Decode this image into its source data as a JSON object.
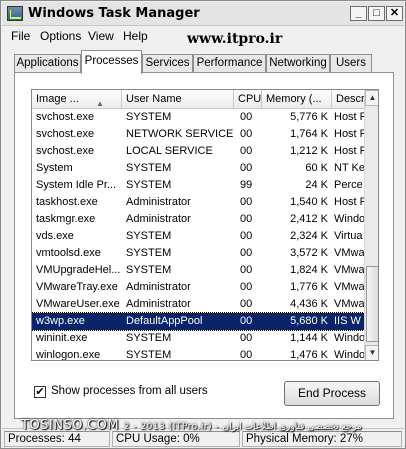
{
  "window": {
    "title": "Windows Task Manager"
  },
  "menu": [
    "File",
    "Options",
    "View",
    "Help"
  ],
  "watermark_top": "www.itpro.ir",
  "tabs": [
    "Applications",
    "Processes",
    "Services",
    "Performance",
    "Networking",
    "Users"
  ],
  "active_tab": "Processes",
  "table": {
    "columns": [
      "Image ...",
      "User Name",
      "CPU",
      "Memory (...",
      "Descr"
    ],
    "rows": [
      {
        "image": "svchost.exe",
        "user": "SYSTEM",
        "cpu": "00",
        "mem": "5,776 K",
        "desc": "Host P"
      },
      {
        "image": "svchost.exe",
        "user": "NETWORK SERVICE",
        "cpu": "00",
        "mem": "1,764 K",
        "desc": "Host P"
      },
      {
        "image": "svchost.exe",
        "user": "LOCAL SERVICE",
        "cpu": "00",
        "mem": "1,212 K",
        "desc": "Host P"
      },
      {
        "image": "System",
        "user": "SYSTEM",
        "cpu": "00",
        "mem": "60 K",
        "desc": "NT Ke"
      },
      {
        "image": "System Idle Pr...",
        "user": "SYSTEM",
        "cpu": "99",
        "mem": "24 K",
        "desc": "Perce"
      },
      {
        "image": "taskhost.exe",
        "user": "Administrator",
        "cpu": "00",
        "mem": "1,540 K",
        "desc": "Host P"
      },
      {
        "image": "taskmgr.exe",
        "user": "Administrator",
        "cpu": "00",
        "mem": "2,412 K",
        "desc": "Windo"
      },
      {
        "image": "vds.exe",
        "user": "SYSTEM",
        "cpu": "00",
        "mem": "2,324 K",
        "desc": "Virtua"
      },
      {
        "image": "vmtoolsd.exe",
        "user": "SYSTEM",
        "cpu": "00",
        "mem": "3,572 K",
        "desc": "VMwa"
      },
      {
        "image": "VMUpgradeHel...",
        "user": "SYSTEM",
        "cpu": "00",
        "mem": "1,824 K",
        "desc": "VMwa"
      },
      {
        "image": "VMwareTray.exe",
        "user": "Administrator",
        "cpu": "00",
        "mem": "1,776 K",
        "desc": "VMwa"
      },
      {
        "image": "VMwareUser.exe",
        "user": "Administrator",
        "cpu": "00",
        "mem": "4,436 K",
        "desc": "VMwa"
      },
      {
        "image": "w3wp.exe",
        "user": "DefaultAppPool",
        "cpu": "00",
        "mem": "5,680 K",
        "desc": "IIS W"
      },
      {
        "image": "wininit.exe",
        "user": "SYSTEM",
        "cpu": "00",
        "mem": "1,144 K",
        "desc": "Windo"
      },
      {
        "image": "winlogon.exe",
        "user": "SYSTEM",
        "cpu": "00",
        "mem": "1,476 K",
        "desc": "Windo"
      }
    ],
    "selected_index": 12
  },
  "show_all": {
    "label": "Show processes from all users",
    "checked": true
  },
  "end_process_label": "End Process",
  "watermark_bottom": "TOSINSO.COM",
  "watermark_bottom_small": "2 - 2013 (ITPro.ir) - مرجع تخصصی فناوری اطلاعات ایران",
  "status": {
    "processes": "Processes: 44",
    "cpu": "CPU Usage: 0%",
    "memory": "Physical Memory: 27%"
  }
}
